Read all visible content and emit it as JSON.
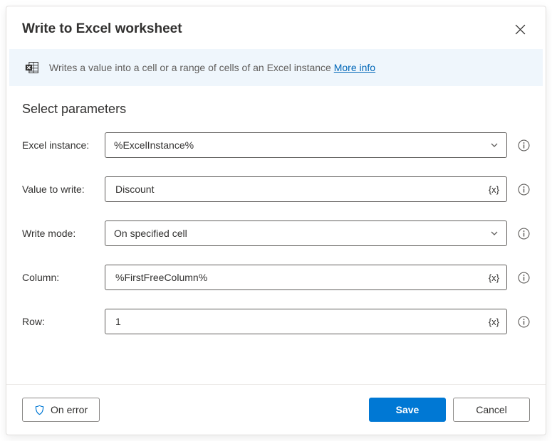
{
  "dialog": {
    "title": "Write to Excel worksheet"
  },
  "banner": {
    "text": "Writes a value into a cell or a range of cells of an Excel instance ",
    "more_link": "More info"
  },
  "section": {
    "title": "Select parameters"
  },
  "fields": {
    "excel_instance": {
      "label": "Excel instance:",
      "value": "%ExcelInstance%"
    },
    "value_to_write": {
      "label": "Value to write:",
      "value": "Discount"
    },
    "write_mode": {
      "label": "Write mode:",
      "value": "On specified cell"
    },
    "column": {
      "label": "Column:",
      "value": "%FirstFreeColumn%"
    },
    "row": {
      "label": "Row:",
      "value": "1"
    }
  },
  "footer": {
    "on_error": "On error",
    "save": "Save",
    "cancel": "Cancel"
  }
}
